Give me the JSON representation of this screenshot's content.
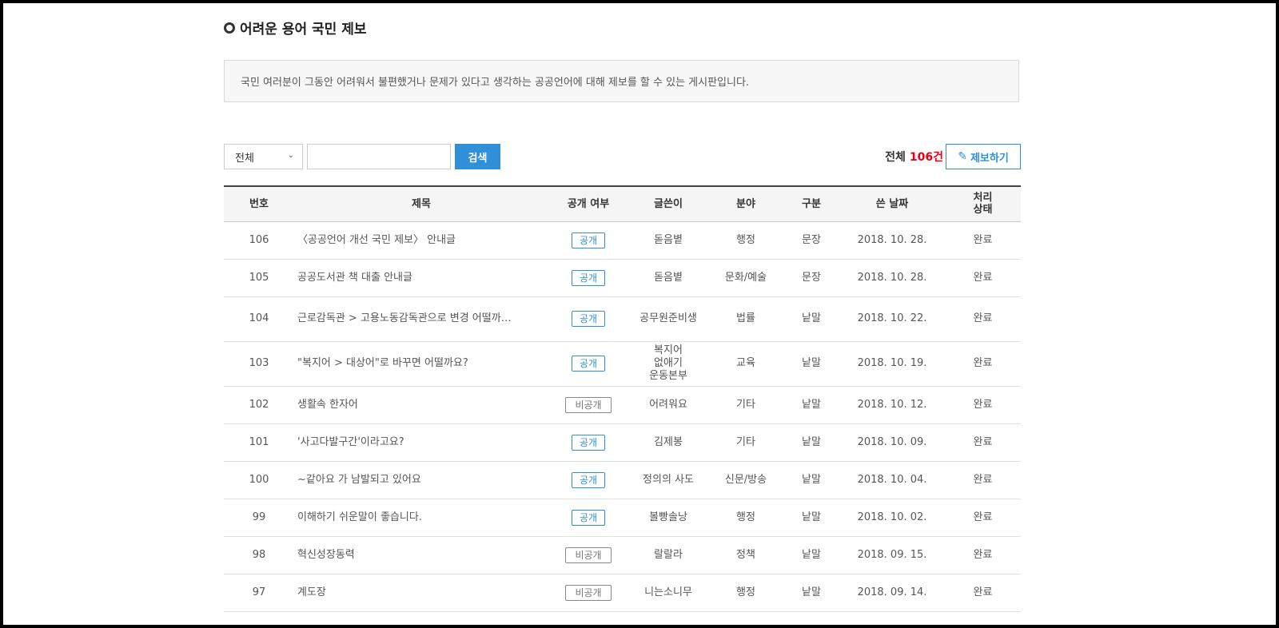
{
  "page": {
    "title": "어려운 용어 국민 제보",
    "notice": "국민 여러분이 그동안 어려워서 불편했거나 문제가 있다고 생각하는 공공언어에 대해 제보를 할 수 있는 게시판입니다."
  },
  "search": {
    "select_value": "전체",
    "input_value": "",
    "button_label": "검색"
  },
  "summary": {
    "total_label": "전체",
    "total_count": "106건",
    "report_label": "제보하기"
  },
  "table": {
    "headers": {
      "no": "번호",
      "title": "제목",
      "open": "공개 여부",
      "author": "글쓴이",
      "field": "분야",
      "type": "구분",
      "date": "쓴 날짜",
      "status": "처리 상태"
    },
    "rows": [
      {
        "no": "106",
        "title": "〈공공언어 개선 국민 제보〉 안내글",
        "open": "공개",
        "author": "돋음볕",
        "field": "행정",
        "type": "문장",
        "date": "2018. 10. 28.",
        "status": "완료"
      },
      {
        "no": "105",
        "title": "공공도서관 책 대출 안내글",
        "open": "공개",
        "author": "돋음볕",
        "field": "문화/예술",
        "type": "문장",
        "date": "2018. 10. 28.",
        "status": "완료"
      },
      {
        "no": "104",
        "title": "근로감독관 > 고용노동감독관으로 변경 어떨까…",
        "open": "공개",
        "author": "공무원준비생",
        "field": "법률",
        "type": "낱말",
        "date": "2018. 10. 22.",
        "status": "완료"
      },
      {
        "no": "103",
        "title": "\"복지어 > 대상어\"로 바꾸면 어떨까요?",
        "open": "공개",
        "author": "복지어 없애기 운동본부",
        "field": "교육",
        "type": "낱말",
        "date": "2018. 10. 19.",
        "status": "완료"
      },
      {
        "no": "102",
        "title": "생활속 한자어",
        "open": "비공개",
        "author": "어려워요",
        "field": "기타",
        "type": "낱말",
        "date": "2018. 10. 12.",
        "status": "완료"
      },
      {
        "no": "101",
        "title": "'사고다발구간'이라고요?",
        "open": "공개",
        "author": "김제봉",
        "field": "기타",
        "type": "낱말",
        "date": "2018. 10. 09.",
        "status": "완료"
      },
      {
        "no": "100",
        "title": "~같아요 가 남발되고 있어요",
        "open": "공개",
        "author": "정의의 사도",
        "field": "신문/방송",
        "type": "낱말",
        "date": "2018. 10. 04.",
        "status": "완료"
      },
      {
        "no": "99",
        "title": "이해하기 쉬운말이 좋습니다.",
        "open": "공개",
        "author": "볼빵솔낭",
        "field": "행정",
        "type": "낱말",
        "date": "2018. 10. 02.",
        "status": "완료"
      },
      {
        "no": "98",
        "title": "혁신성장동력",
        "open": "비공개",
        "author": "랄랄라",
        "field": "정책",
        "type": "낱말",
        "date": "2018. 09. 15.",
        "status": "완료"
      },
      {
        "no": "97",
        "title": "계도장",
        "open": "비공개",
        "author": "니는소니무",
        "field": "행정",
        "type": "낱말",
        "date": "2018. 09. 14.",
        "status": "완료"
      }
    ]
  }
}
